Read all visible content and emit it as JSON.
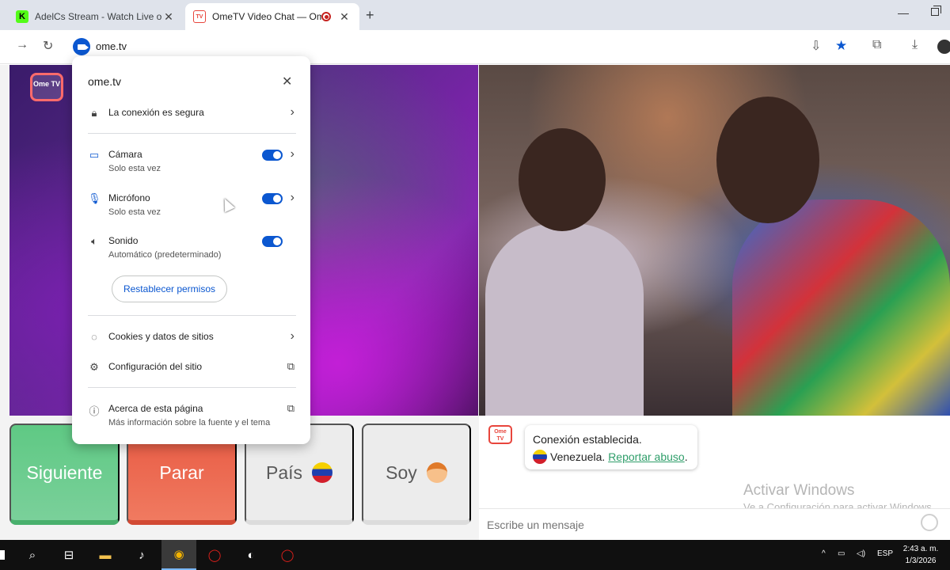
{
  "browser": {
    "tabs": [
      {
        "title": "AdelCs Stream - Watch Live on",
        "icon": "kick-icon"
      },
      {
        "title": "OmeTV Video Chat — Ome",
        "icon": "ometv-icon",
        "recording": true
      }
    ],
    "new_tab_label": "+",
    "url": "ome.tv"
  },
  "site_info": {
    "domain": "ome.tv",
    "connection": "La conexión es segura",
    "permissions": [
      {
        "name": "Cámara",
        "detail": "Solo esta vez",
        "enabled": true,
        "icon": "camera-icon"
      },
      {
        "name": "Micrófono",
        "detail": "Solo esta vez",
        "enabled": true,
        "icon": "microphone-icon"
      },
      {
        "name": "Sonido",
        "detail": "Automático (predeterminado)",
        "enabled": true,
        "icon": "speaker-icon"
      }
    ],
    "reset_label": "Restablecer permisos",
    "cookies": "Cookies y datos de sitios",
    "settings": "Configuración del sitio",
    "about": "Acerca de esta página",
    "about_detail": "Más información sobre la fuente y el tema"
  },
  "controls": {
    "next": "Siguiente",
    "stop": "Parar",
    "country": "País",
    "me": "Soy"
  },
  "video": {
    "logo_text": "Ome TV"
  },
  "chat": {
    "logo_text": "Ome TV",
    "status": "Conexión establecida.",
    "country": "Venezuela.",
    "report": "Reportar abuso",
    "report_suffix": ".",
    "placeholder": "Escribe un mensaje",
    "watermark_title": "Activar Windows",
    "watermark_sub": "Ve a Configuración para activar Windows."
  },
  "taskbar": {
    "lang": "ESP",
    "time": "2:43 a. m.",
    "date": "1/3/2026"
  },
  "colors": {
    "accent": "#0b57d0",
    "next_green": "#5fc984",
    "stop_red": "#e85a43"
  }
}
